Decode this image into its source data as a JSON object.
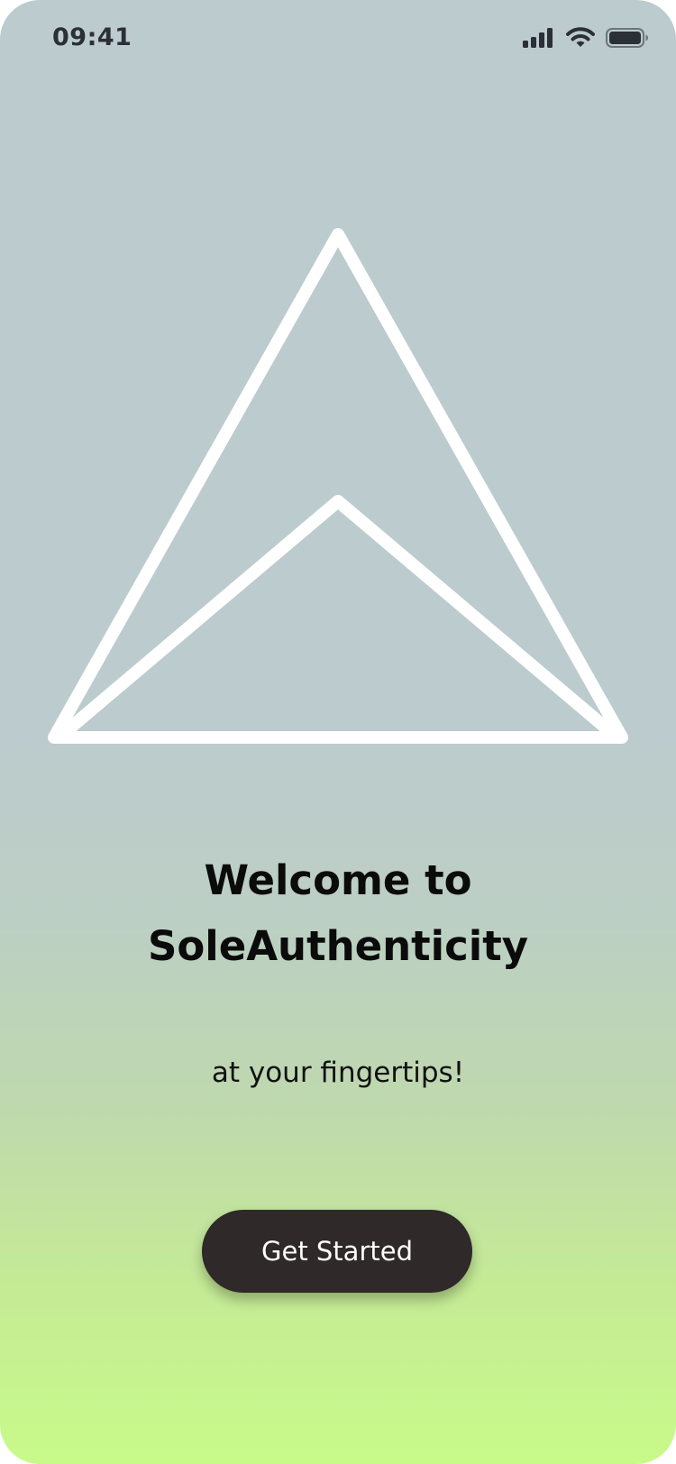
{
  "status_bar": {
    "time": "09:41",
    "icons": [
      "cellular-signal-icon",
      "wifi-icon",
      "battery-icon"
    ],
    "icon_color": "#2b2f36"
  },
  "logo": {
    "icon": "triangle-logo-icon",
    "color": "#ffffff"
  },
  "welcome": {
    "title_line1": "Welcome to",
    "title_line2": "SoleAuthenticity",
    "tagline": "at your fingertips!"
  },
  "cta": {
    "label": "Get Started",
    "background": "#2f2929",
    "text_color": "#ffffff"
  },
  "background": {
    "gradient_top": "#bccbcd",
    "gradient_bottom": "#c8fa8a"
  }
}
